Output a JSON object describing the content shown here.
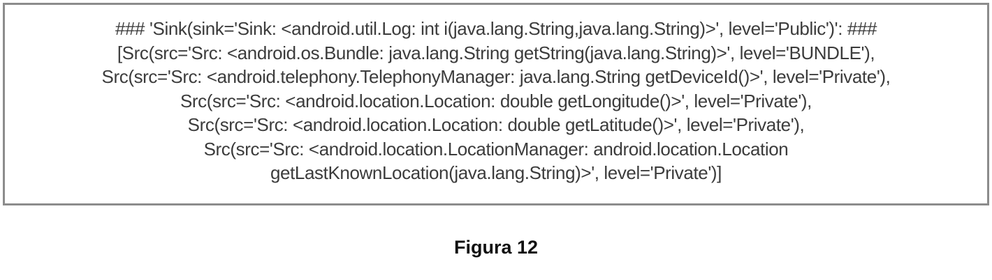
{
  "figure": {
    "lines": [
      "### 'Sink(sink='Sink: <android.util.Log: int i(java.lang.String,java.lang.String)>', level='Public')': ###",
      "[Src(src='Src: <android.os.Bundle: java.lang.String getString(java.lang.String)>', level='BUNDLE'),",
      "Src(src='Src: <android.telephony.TelephonyManager: java.lang.String getDeviceId()>', level='Private'),",
      "Src(src='Src: <android.location.Location: double getLongitude()>', level='Private'),",
      "Src(src='Src: <android.location.Location: double getLatitude()>', level='Private'),",
      "Src(src='Src: <android.location.LocationManager: android.location.Location",
      "getLastKnownLocation(java.lang.String)>', level='Private')]"
    ],
    "caption": "Figura 12"
  }
}
